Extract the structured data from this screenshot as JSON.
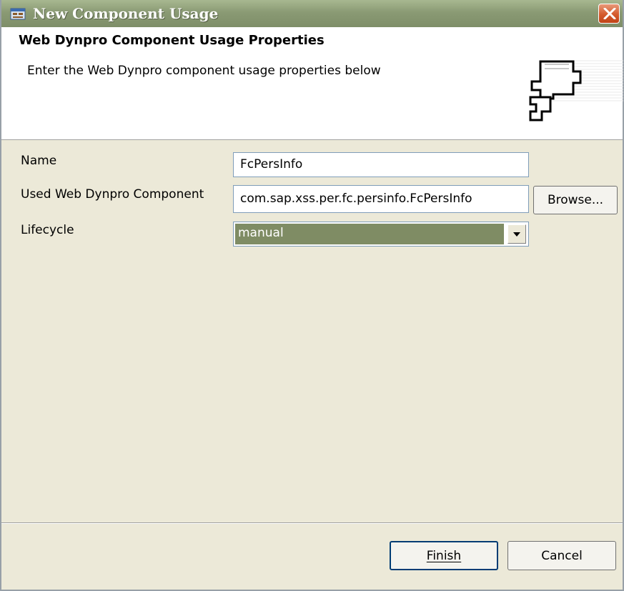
{
  "window": {
    "title": "New Component Usage",
    "icon": "component-window-icon",
    "close_icon": "close-icon"
  },
  "header": {
    "title": "Web Dynpro Component Usage Properties",
    "description": "Enter the Web Dynpro component usage properties below",
    "art_icon": "component-puzzle-icon"
  },
  "form": {
    "name_label": "Name",
    "name_value": "FcPersInfo",
    "component_label": "Used Web Dynpro Component",
    "component_value": "com.sap.xss.per.fc.persinfo.FcPersInfo",
    "browse_label": "Browse...",
    "lifecycle_label": "Lifecycle",
    "lifecycle_value": "manual"
  },
  "footer": {
    "finish_label": "Finish",
    "cancel_label": "Cancel"
  },
  "colors": {
    "title_bar": "#8a9a74",
    "close_button": "#d45a2c",
    "selection": "#7f8c64",
    "dialog_bg": "#ece9d8"
  }
}
